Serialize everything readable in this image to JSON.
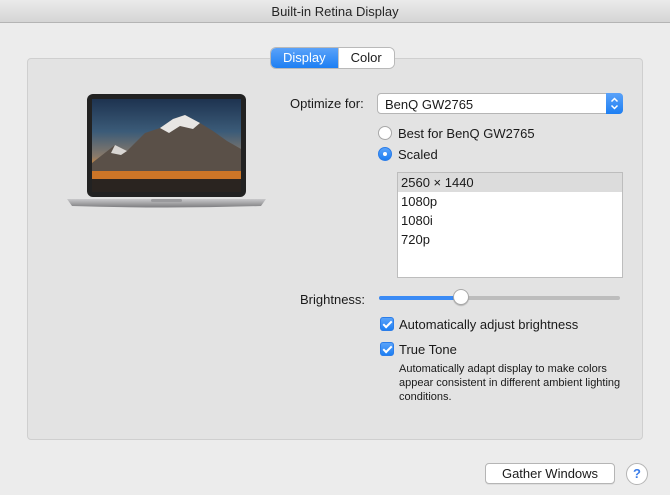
{
  "window": {
    "title": "Built-in Retina Display"
  },
  "tabs": [
    {
      "label": "Display",
      "active": true
    },
    {
      "label": "Color",
      "active": false
    }
  ],
  "optimize": {
    "label": "Optimize for:",
    "selected": "BenQ GW2765",
    "icon": "popup-chevrons-icon"
  },
  "resolution": {
    "options": [
      {
        "label": "Best for BenQ GW2765",
        "selected": false
      },
      {
        "label": "Scaled",
        "selected": true
      }
    ],
    "scaled_list": [
      "2560 × 1440",
      "1080p",
      "1080i",
      "720p"
    ],
    "selected_index": 0
  },
  "brightness": {
    "label": "Brightness:",
    "level": 0.34,
    "auto_label": "Automatically adjust brightness",
    "auto_checked": true
  },
  "true_tone": {
    "label": "True Tone",
    "checked": true,
    "description": "Automatically adapt display to make colors appear consistent in different ambient lighting conditions."
  },
  "footer": {
    "gather_label": "Gather Windows",
    "help_label": "?"
  },
  "colors": {
    "accent": "#1d7ff3",
    "window_bg": "#ececec",
    "panel_bg": "#e3e3e3"
  },
  "laptop_icon": "macbook-pro-icon"
}
